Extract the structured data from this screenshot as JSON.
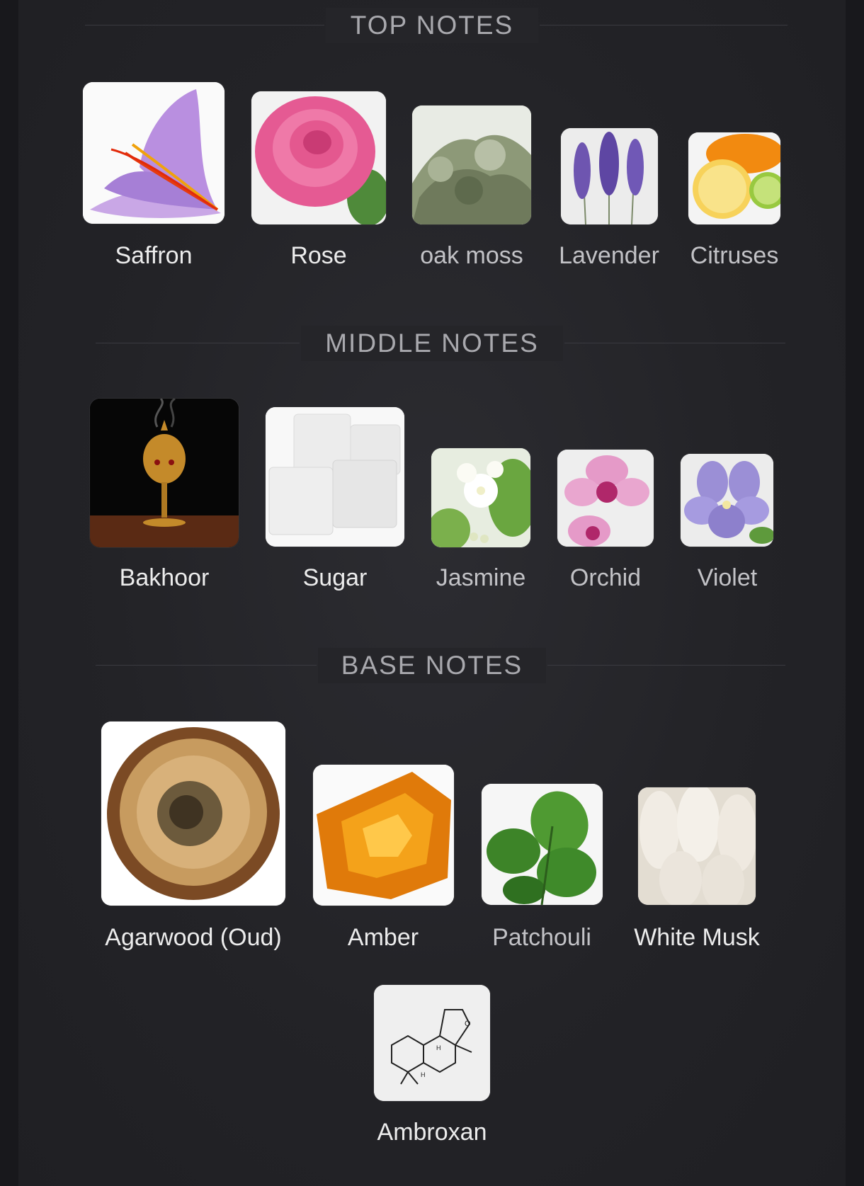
{
  "sections": {
    "top": {
      "title": "TOP NOTES",
      "notes": [
        "Saffron",
        "Rose",
        "oak moss",
        "Lavender",
        "Citruses"
      ]
    },
    "middle": {
      "title": "MIDDLE NOTES",
      "notes": [
        "Bakhoor",
        "Sugar",
        "Jasmine",
        "Orchid",
        "Violet"
      ]
    },
    "base": {
      "title": "BASE NOTES",
      "notes": [
        "Agarwood (Oud)",
        "Amber",
        "Patchouli",
        "White Musk",
        "Ambroxan"
      ]
    }
  },
  "icons": {
    "top": [
      "saffron-icon",
      "rose-icon",
      "oak-moss-icon",
      "lavender-icon",
      "citruses-icon"
    ],
    "middle": [
      "bakhoor-icon",
      "sugar-icon",
      "jasmine-icon",
      "orchid-icon",
      "violet-icon"
    ],
    "base": [
      "agarwood-icon",
      "amber-icon",
      "patchouli-icon",
      "white-musk-icon",
      "ambroxan-icon"
    ]
  },
  "colors": {
    "background": "#232327",
    "heading": "#a9a9ae",
    "label_bright": "#ececec",
    "label_dim": "#c2c2c6"
  }
}
